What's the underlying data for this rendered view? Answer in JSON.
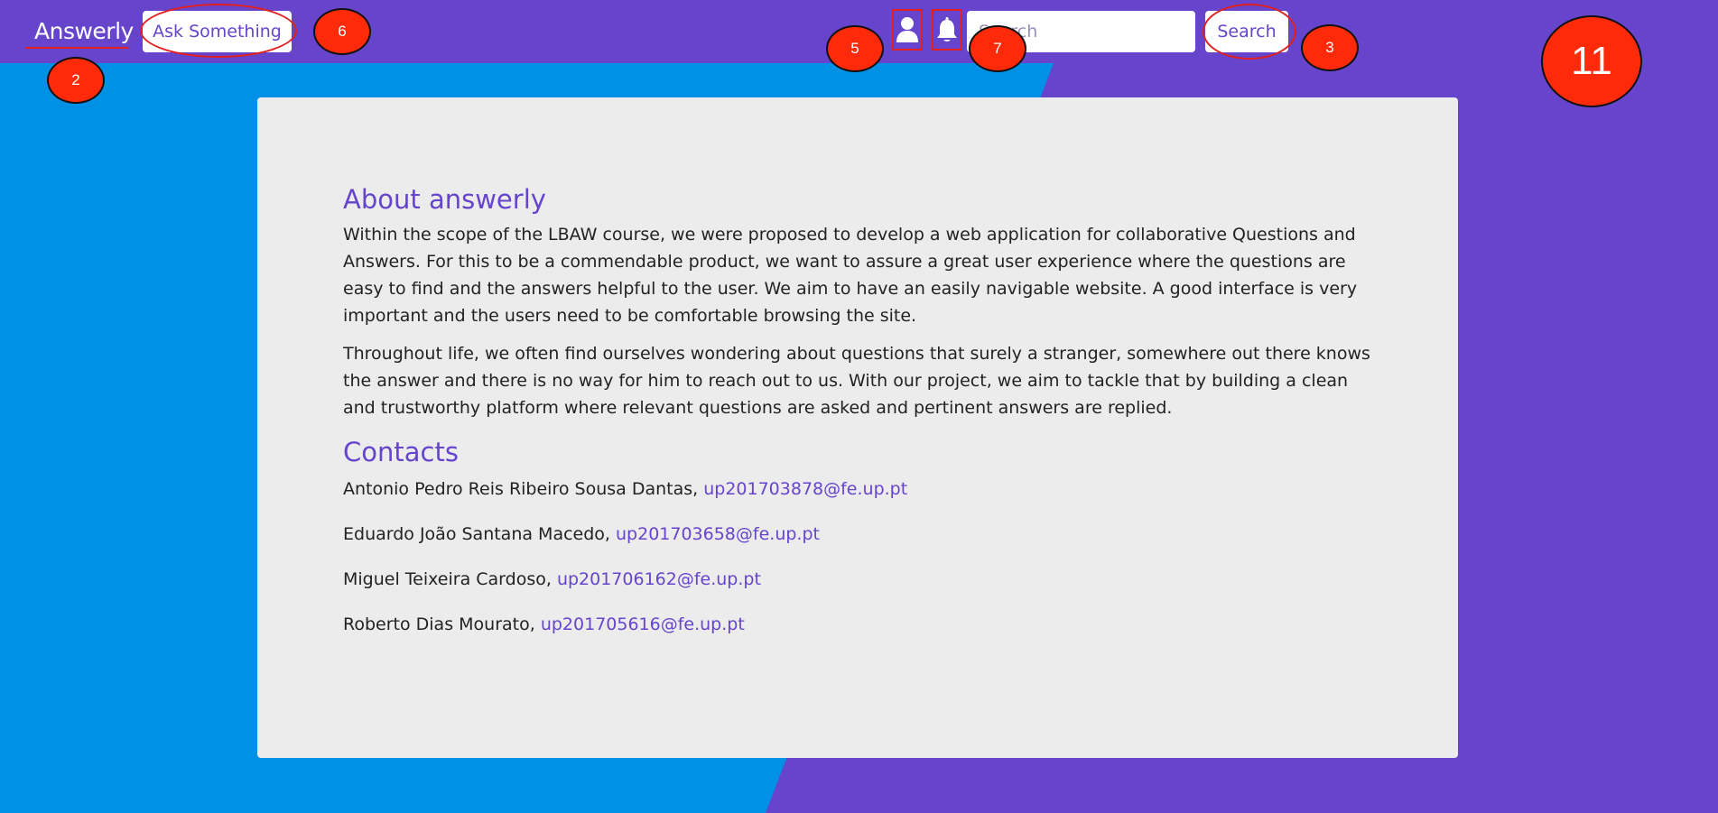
{
  "navbar": {
    "brand": "Answerly",
    "ask_button": "Ask Something",
    "search_placeholder": "Search",
    "search_button": "Search"
  },
  "markers": {
    "brand": "2",
    "search": "3",
    "profile": "5",
    "ask": "6",
    "notifications": "7",
    "page": "11"
  },
  "main": {
    "about_title": "About answerly",
    "about_paragraphs": [
      "Within the scope of the LBAW course, we were proposed to develop a web application for collaborative Questions and Answers. For this to be a commendable product, we want to assure a great user experience where the questions are easy to find and the answers helpful to the user. We aim to have an easily navigable website. A good interface is very important and the users need to be comfortable browsing the site.",
      "Throughout life, we often find ourselves wondering about questions that surely a stranger, somewhere out there knows the answer and there is no way for him to reach out to us. With our project, we aim to tackle that by building a clean and trustworthy platform where relevant questions are asked and pertinent answers are replied."
    ],
    "contacts_title": "Contacts",
    "contacts": [
      {
        "name": "Antonio Pedro Reis Ribeiro Sousa Dantas,",
        "email": "up201703878@fe.up.pt"
      },
      {
        "name": "Eduardo João Santana Macedo,",
        "email": "up201703658@fe.up.pt"
      },
      {
        "name": "Miguel Teixeira Cardoso,",
        "email": "up201706162@fe.up.pt"
      },
      {
        "name": "Roberto Dias Mourato,",
        "email": "up201705616@fe.up.pt"
      }
    ]
  },
  "colors": {
    "primary": "#6644cc",
    "background_blue": "#0090e6",
    "card": "#ececec",
    "annotation_red": "#ff2a0a"
  },
  "icons": {
    "profile": "user-icon",
    "notifications": "bell-icon"
  }
}
